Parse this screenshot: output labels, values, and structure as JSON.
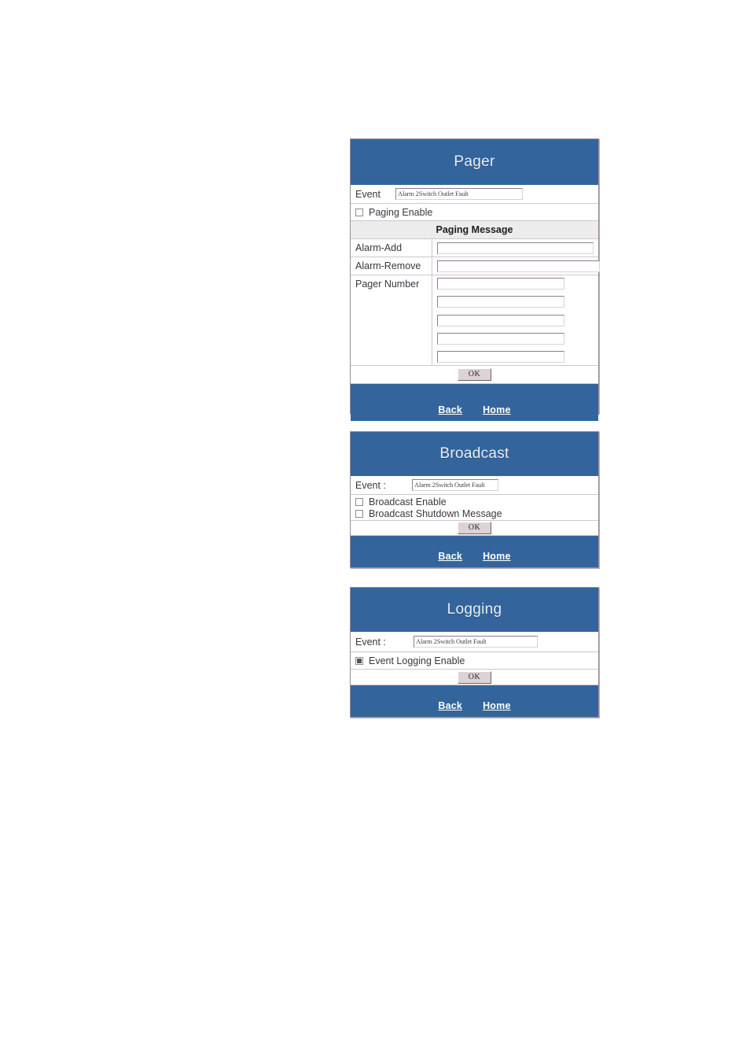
{
  "panels": [
    {
      "id": "pager",
      "title": "Pager",
      "event_label": "Event",
      "event_value": "Alarm 2Switch Outlet Fault",
      "enable_label": "Paging Enable",
      "enable_checked": false,
      "section_header": "Paging Message",
      "fields": [
        {
          "label": "Alarm-Add",
          "value": ""
        },
        {
          "label": "Alarm-Remove",
          "value": ""
        }
      ],
      "pager_number_label": "Pager Number",
      "pager_numbers": [
        "",
        "",
        "",
        "",
        ""
      ],
      "ok_label": "OK",
      "back_label": "Back",
      "home_label": "Home"
    },
    {
      "id": "broadcast",
      "title": "Broadcast",
      "event_label": "Event :",
      "event_value": "Alarm 2Switch Outlet Fault",
      "checkboxes": [
        {
          "label": "Broadcast Enable",
          "checked": false
        },
        {
          "label": "Broadcast Shutdown Message",
          "checked": false
        }
      ],
      "ok_label": "OK",
      "back_label": "Back",
      "home_label": "Home"
    },
    {
      "id": "logging",
      "title": "Logging",
      "event_label": "Event :",
      "event_value": "Alarm 2Switch Outlet Fault",
      "checkboxes": [
        {
          "label": "Event Logging Enable",
          "checked": true
        }
      ],
      "ok_label": "OK",
      "back_label": "Back",
      "home_label": "Home"
    }
  ],
  "colors": {
    "header_blue": "#33659c",
    "section_gray": "#ececec",
    "border": "#9a8a9a",
    "button_face": "#ddd2d6"
  }
}
